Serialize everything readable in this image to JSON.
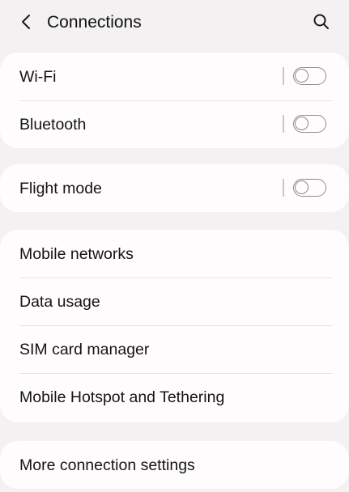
{
  "header": {
    "title": "Connections",
    "back_icon": "chevron-left-icon",
    "search_icon": "search-icon"
  },
  "groups": {
    "wireless": {
      "wifi": {
        "label": "Wi-Fi",
        "enabled": false
      },
      "bluetooth": {
        "label": "Bluetooth",
        "enabled": false
      }
    },
    "flight": {
      "flight_mode": {
        "label": "Flight mode",
        "enabled": false
      }
    },
    "network": {
      "mobile_networks": {
        "label": "Mobile networks"
      },
      "data_usage": {
        "label": "Data usage"
      },
      "sim_card_manager": {
        "label": "SIM card manager"
      },
      "hotspot": {
        "label": "Mobile Hotspot and Tethering"
      }
    },
    "more": {
      "more_settings": {
        "label": "More connection settings"
      }
    }
  },
  "colors": {
    "background": "#f3f1f1",
    "card": "#fefcfc",
    "text": "#141414",
    "toggle_off": "#8e8b8b"
  }
}
